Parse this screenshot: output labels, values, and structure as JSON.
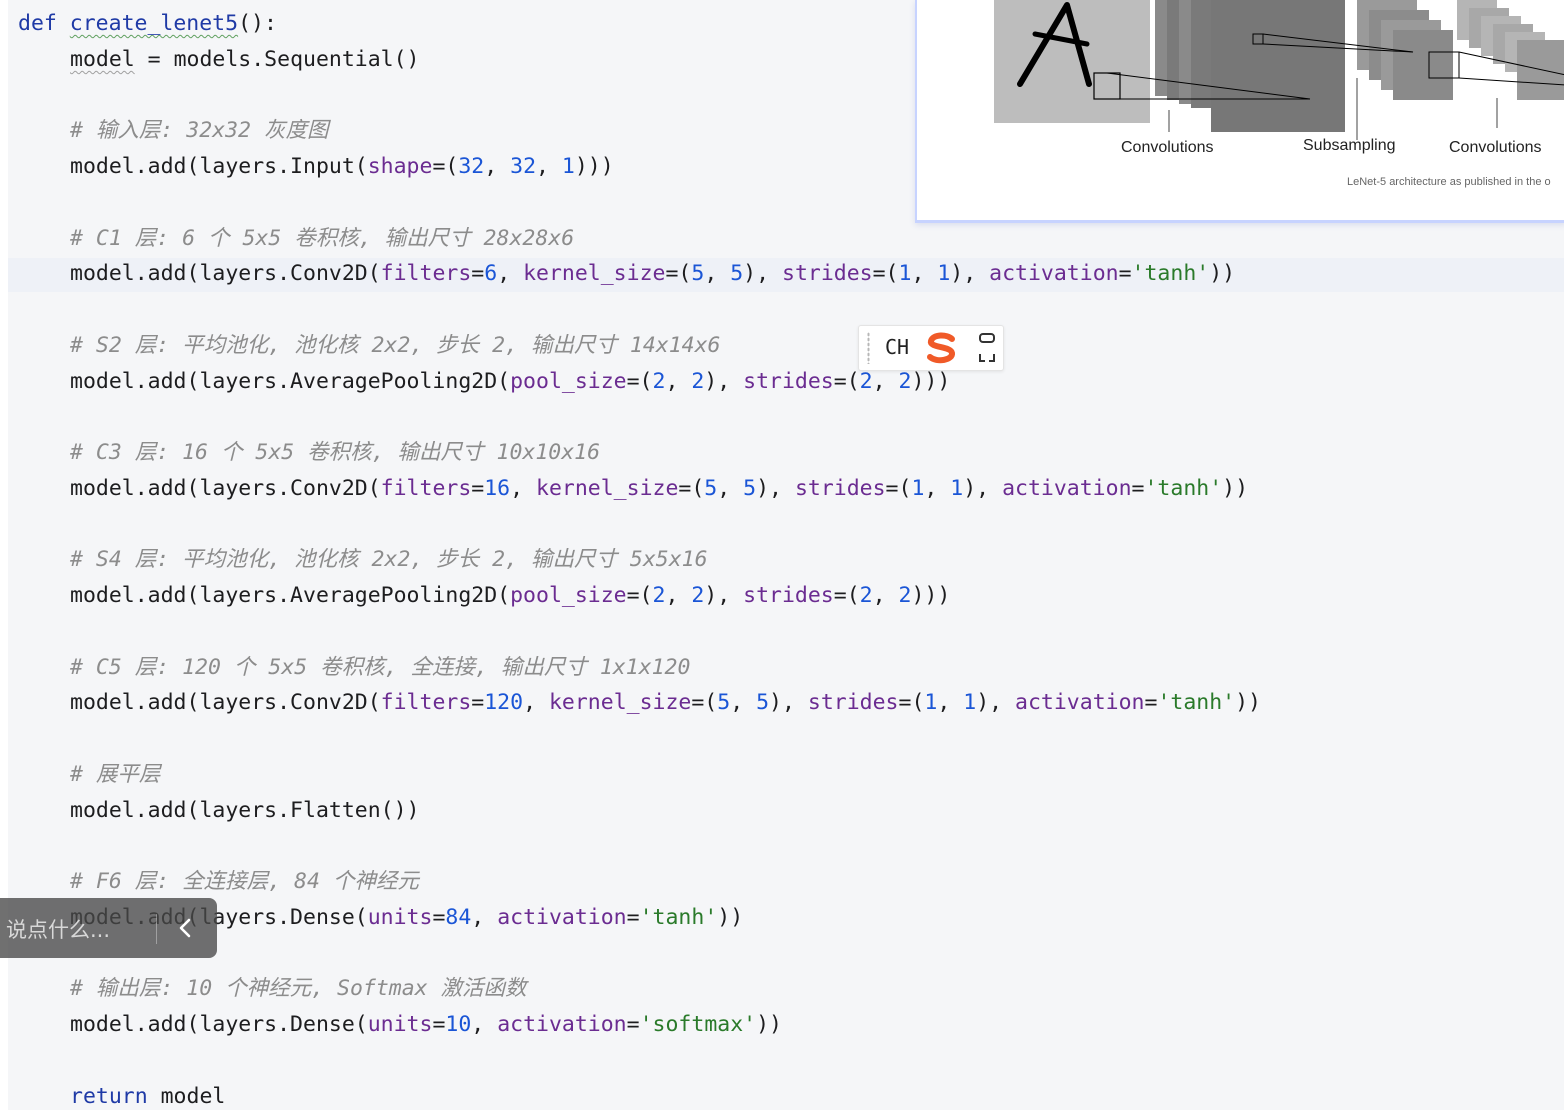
{
  "editor": {
    "lines": [
      {
        "type": "code",
        "indent": 0,
        "tokens": [
          {
            "t": "def",
            "c": "keyword"
          },
          {
            "t": " "
          },
          {
            "t": "create_lenet5",
            "c": "fn",
            "squiggle": "green"
          },
          {
            "t": "():"
          }
        ]
      },
      {
        "type": "code",
        "indent": 1,
        "tokens": [
          {
            "t": "model",
            "squiggle": "gray"
          },
          {
            "t": " = models.Sequential()"
          }
        ]
      },
      {
        "type": "blank"
      },
      {
        "type": "comment",
        "indent": 1,
        "text": "# 输入层: 32x32 灰度图"
      },
      {
        "type": "code",
        "indent": 1,
        "tokens": [
          {
            "t": "model.add(layers.Input("
          },
          {
            "t": "shape",
            "c": "kwarg"
          },
          {
            "t": "=("
          },
          {
            "t": "32",
            "c": "number"
          },
          {
            "t": ", "
          },
          {
            "t": "32",
            "c": "number"
          },
          {
            "t": ", "
          },
          {
            "t": "1",
            "c": "number"
          },
          {
            "t": ")))"
          }
        ]
      },
      {
        "type": "blank"
      },
      {
        "type": "comment",
        "indent": 1,
        "text": "# C1 层: 6 个 5x5 卷积核, 输出尺寸 28x28x6"
      },
      {
        "type": "code",
        "indent": 1,
        "tokens": [
          {
            "t": "model.add(layers.Conv2D("
          },
          {
            "t": "filters",
            "c": "kwarg"
          },
          {
            "t": "="
          },
          {
            "t": "6",
            "c": "number"
          },
          {
            "t": ", "
          },
          {
            "t": "kernel_size",
            "c": "kwarg"
          },
          {
            "t": "=("
          },
          {
            "t": "5",
            "c": "number"
          },
          {
            "t": ", "
          },
          {
            "t": "5",
            "c": "number"
          },
          {
            "t": "), "
          },
          {
            "t": "strides",
            "c": "kwarg"
          },
          {
            "t": "=("
          },
          {
            "t": "1",
            "c": "number"
          },
          {
            "t": ", "
          },
          {
            "t": "1",
            "c": "number"
          },
          {
            "t": "), "
          },
          {
            "t": "activation",
            "c": "kwarg"
          },
          {
            "t": "="
          },
          {
            "t": "'tanh'",
            "c": "string"
          },
          {
            "t": "))"
          }
        ]
      },
      {
        "type": "blank"
      },
      {
        "type": "comment",
        "indent": 1,
        "text": "# S2 层: 平均池化, 池化核 2x2, 步长 2, 输出尺寸 14x14x6"
      },
      {
        "type": "code",
        "indent": 1,
        "tokens": [
          {
            "t": "model.add(layers.AveragePooling2D("
          },
          {
            "t": "pool_size",
            "c": "kwarg"
          },
          {
            "t": "=("
          },
          {
            "t": "2",
            "c": "number"
          },
          {
            "t": ", "
          },
          {
            "t": "2",
            "c": "number"
          },
          {
            "t": "), "
          },
          {
            "t": "strides",
            "c": "kwarg"
          },
          {
            "t": "=("
          },
          {
            "t": "2",
            "c": "number"
          },
          {
            "t": ", "
          },
          {
            "t": "2",
            "c": "number"
          },
          {
            "t": ")))"
          }
        ]
      },
      {
        "type": "blank"
      },
      {
        "type": "comment",
        "indent": 1,
        "text": "# C3 层: 16 个 5x5 卷积核, 输出尺寸 10x10x16"
      },
      {
        "type": "code",
        "indent": 1,
        "tokens": [
          {
            "t": "model.add(layers.Conv2D("
          },
          {
            "t": "filters",
            "c": "kwarg"
          },
          {
            "t": "="
          },
          {
            "t": "16",
            "c": "number"
          },
          {
            "t": ", "
          },
          {
            "t": "kernel_size",
            "c": "kwarg"
          },
          {
            "t": "=("
          },
          {
            "t": "5",
            "c": "number"
          },
          {
            "t": ", "
          },
          {
            "t": "5",
            "c": "number"
          },
          {
            "t": "), "
          },
          {
            "t": "strides",
            "c": "kwarg"
          },
          {
            "t": "=("
          },
          {
            "t": "1",
            "c": "number"
          },
          {
            "t": ", "
          },
          {
            "t": "1",
            "c": "number"
          },
          {
            "t": "), "
          },
          {
            "t": "activation",
            "c": "kwarg"
          },
          {
            "t": "="
          },
          {
            "t": "'tanh'",
            "c": "string"
          },
          {
            "t": "))"
          }
        ]
      },
      {
        "type": "blank"
      },
      {
        "type": "comment",
        "indent": 1,
        "text": "# S4 层: 平均池化, 池化核 2x2, 步长 2, 输出尺寸 5x5x16"
      },
      {
        "type": "code",
        "indent": 1,
        "tokens": [
          {
            "t": "model.add(layers.AveragePooling2D("
          },
          {
            "t": "pool_size",
            "c": "kwarg"
          },
          {
            "t": "=("
          },
          {
            "t": "2",
            "c": "number"
          },
          {
            "t": ", "
          },
          {
            "t": "2",
            "c": "number"
          },
          {
            "t": "), "
          },
          {
            "t": "strides",
            "c": "kwarg"
          },
          {
            "t": "=("
          },
          {
            "t": "2",
            "c": "number"
          },
          {
            "t": ", "
          },
          {
            "t": "2",
            "c": "number"
          },
          {
            "t": ")))"
          }
        ]
      },
      {
        "type": "blank"
      },
      {
        "type": "comment",
        "indent": 1,
        "text": "# C5 层: 120 个 5x5 卷积核, 全连接, 输出尺寸 1x1x120"
      },
      {
        "type": "code",
        "indent": 1,
        "tokens": [
          {
            "t": "model.add(layers.Conv2D("
          },
          {
            "t": "filters",
            "c": "kwarg"
          },
          {
            "t": "="
          },
          {
            "t": "120",
            "c": "number"
          },
          {
            "t": ", "
          },
          {
            "t": "kernel_size",
            "c": "kwarg"
          },
          {
            "t": "=("
          },
          {
            "t": "5",
            "c": "number"
          },
          {
            "t": ", "
          },
          {
            "t": "5",
            "c": "number"
          },
          {
            "t": "), "
          },
          {
            "t": "strides",
            "c": "kwarg"
          },
          {
            "t": "=("
          },
          {
            "t": "1",
            "c": "number"
          },
          {
            "t": ", "
          },
          {
            "t": "1",
            "c": "number"
          },
          {
            "t": "), "
          },
          {
            "t": "activation",
            "c": "kwarg"
          },
          {
            "t": "="
          },
          {
            "t": "'tanh'",
            "c": "string"
          },
          {
            "t": "))"
          }
        ]
      },
      {
        "type": "blank"
      },
      {
        "type": "comment",
        "indent": 1,
        "text": "# 展平层"
      },
      {
        "type": "code",
        "indent": 1,
        "tokens": [
          {
            "t": "model.add(layers.Flatten())"
          }
        ]
      },
      {
        "type": "blank"
      },
      {
        "type": "comment",
        "indent": 1,
        "text": "# F6 层: 全连接层, 84 个神经元"
      },
      {
        "type": "code",
        "indent": 1,
        "tokens": [
          {
            "t": "model.add(layers.Dense("
          },
          {
            "t": "units",
            "c": "kwarg"
          },
          {
            "t": "="
          },
          {
            "t": "84",
            "c": "number"
          },
          {
            "t": ", "
          },
          {
            "t": "activation",
            "c": "kwarg"
          },
          {
            "t": "="
          },
          {
            "t": "'tanh'",
            "c": "string"
          },
          {
            "t": "))"
          }
        ]
      },
      {
        "type": "blank"
      },
      {
        "type": "comment",
        "indent": 1,
        "text": "# 输出层: 10 个神经元, Softmax 激活函数"
      },
      {
        "type": "code",
        "indent": 1,
        "tokens": [
          {
            "t": "model.add(layers.Dense("
          },
          {
            "t": "units",
            "c": "kwarg"
          },
          {
            "t": "="
          },
          {
            "t": "10",
            "c": "number"
          },
          {
            "t": ", "
          },
          {
            "t": "activation",
            "c": "kwarg"
          },
          {
            "t": "="
          },
          {
            "t": "'softmax'",
            "c": "string"
          },
          {
            "t": "))"
          }
        ]
      },
      {
        "type": "blank"
      },
      {
        "type": "code",
        "indent": 1,
        "tokens": [
          {
            "t": "return",
            "c": "keyword"
          },
          {
            "t": " model"
          }
        ]
      }
    ]
  },
  "lenet_panel": {
    "labels": [
      "Convolutions",
      "Subsampling",
      "Convolutions"
    ],
    "caption": "LeNet-5 architecture as published in the o"
  },
  "ime": {
    "mode_label": "CH",
    "logo_icon": "sogou-s-icon",
    "expand_icon": "expand-corners-icon"
  },
  "comment_bar": {
    "placeholder": "说点什么...",
    "collapse_icon": "chevron-left-icon"
  },
  "colors": {
    "editor_bg": "#f5f6f8",
    "keyword": "#1f3aa6",
    "kwarg": "#6b2c91",
    "number": "#1a55d6",
    "string": "#2a7a2a",
    "comment": "#8c8c8c",
    "ime_logo": "#f05a28"
  }
}
